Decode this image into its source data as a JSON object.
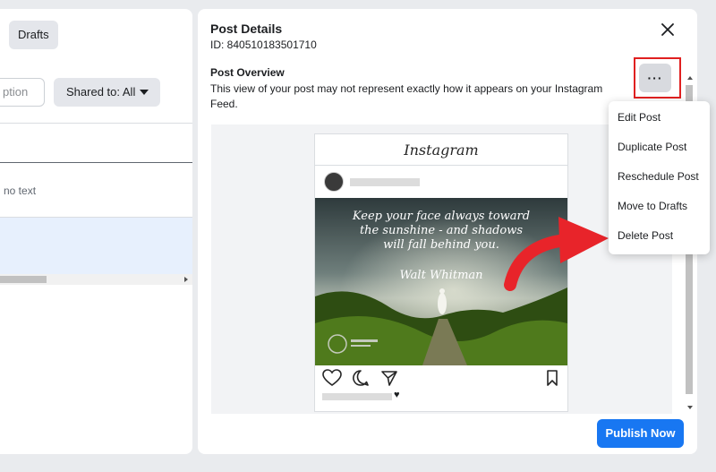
{
  "left_panel": {
    "drafts_label": "Drafts",
    "caption_placeholder": "ption",
    "shared_label": "Shared to: All",
    "row_text": "no text"
  },
  "details": {
    "title": "Post Details",
    "id_text": "ID: 840510183501710",
    "overview_title": "Post Overview",
    "overview_desc": "This view of your post may not represent exactly how it appears on your Instagram Feed.",
    "more_label": "···"
  },
  "preview": {
    "platform_name": "Instagram",
    "image_text_lines": [
      "Keep your face always toward",
      "the sunshine - and shadows",
      "will fall behind you."
    ],
    "image_author": "Walt Whitman"
  },
  "menu": {
    "items": [
      "Edit Post",
      "Duplicate Post",
      "Reschedule Post",
      "Move to Drafts",
      "Delete Post"
    ]
  },
  "actions": {
    "publish_label": "Publish Now"
  },
  "colors": {
    "accent": "#1877f2",
    "highlight": "#e02020",
    "arrow": "#e8242a"
  }
}
